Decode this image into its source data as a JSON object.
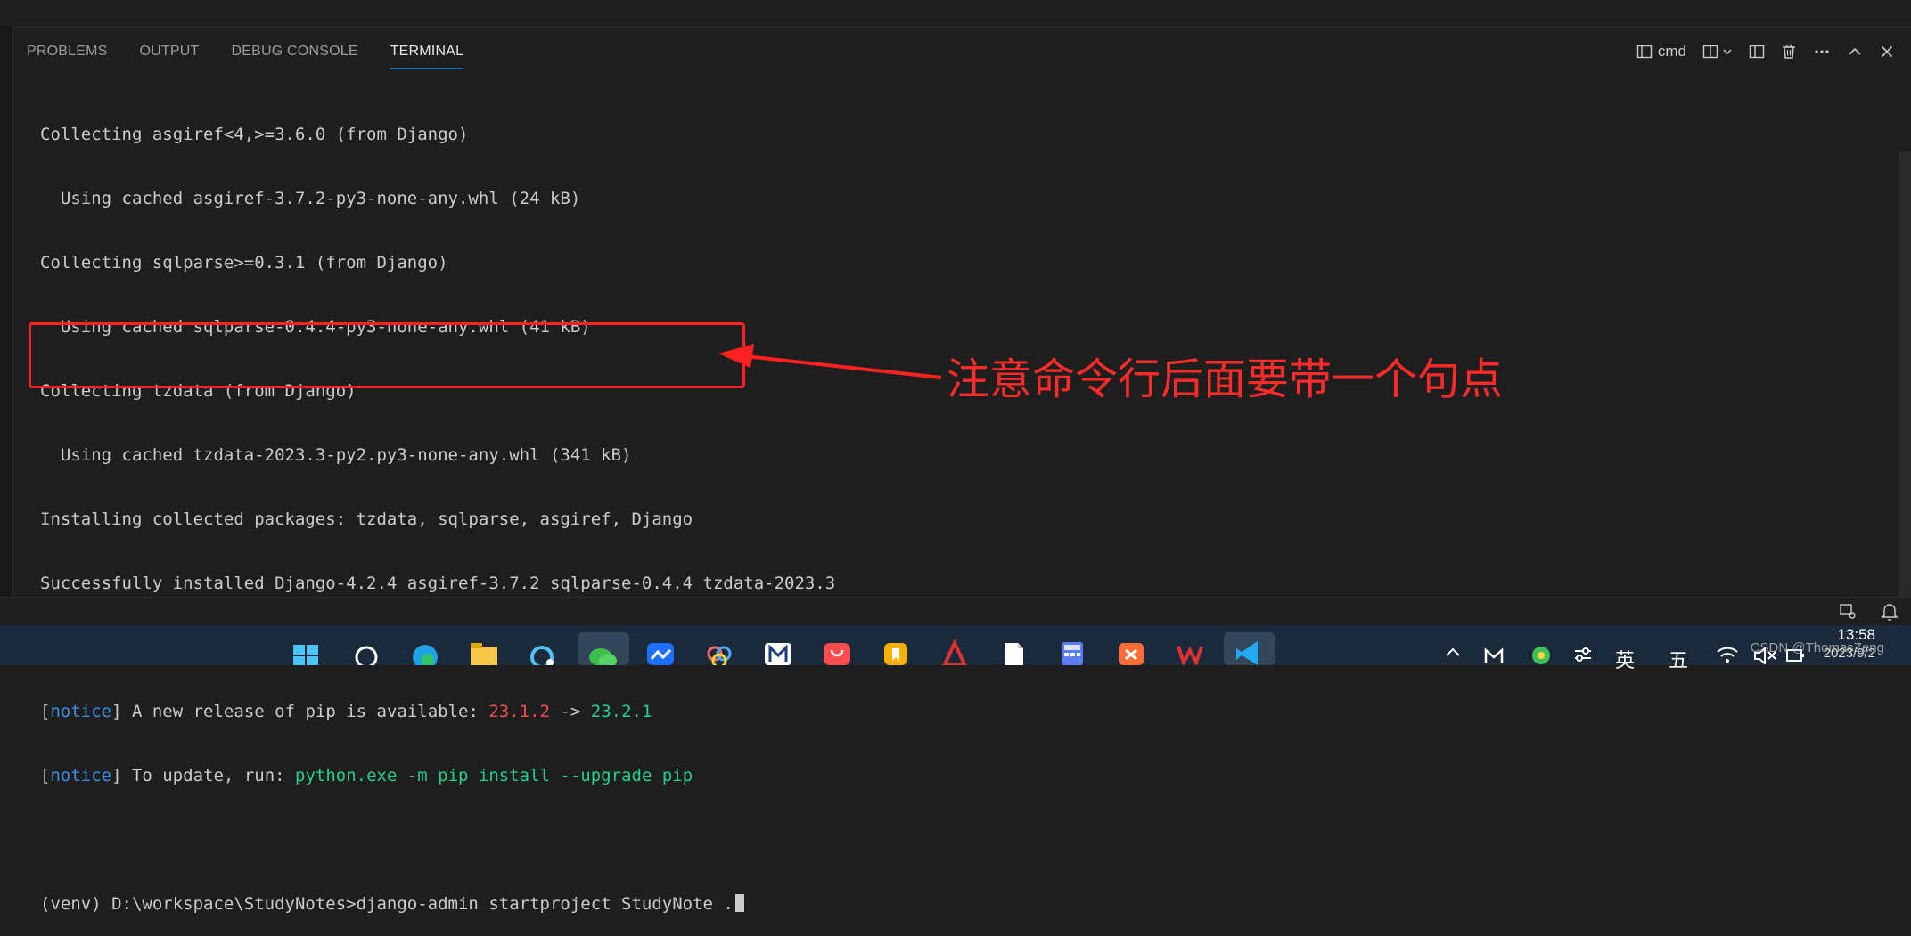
{
  "panel": {
    "tabs": [
      {
        "label": "PROBLEMS",
        "active": false
      },
      {
        "label": "OUTPUT",
        "active": false
      },
      {
        "label": "DEBUG CONSOLE",
        "active": false
      },
      {
        "label": "TERMINAL",
        "active": true
      }
    ],
    "actions": {
      "terminal_name": "cmd",
      "icons": [
        "terminal-icon",
        "split-terminal-icon",
        "chevron-down-icon",
        "split-editor-icon",
        "trash-icon",
        "more-icon",
        "maximize-icon",
        "close-icon"
      ]
    }
  },
  "terminal": {
    "lines": [
      "Collecting asgiref<4,>=3.6.0 (from Django)",
      "  Using cached asgiref-3.7.2-py3-none-any.whl (24 kB)",
      "Collecting sqlparse>=0.3.1 (from Django)",
      "  Using cached sqlparse-0.4.4-py3-none-any.whl (41 kB)",
      "Collecting tzdata (from Django)",
      "  Using cached tzdata-2023.3-py2.py3-none-any.whl (341 kB)",
      "Installing collected packages: tzdata, sqlparse, asgiref, Django",
      "Successfully installed Django-4.2.4 asgiref-3.7.2 sqlparse-0.4.4 tzdata-2023.3"
    ],
    "notice1": {
      "open": "[",
      "tag": "notice",
      "close": "]",
      "text": " A new release of pip is available: ",
      "old_version": "23.1.2",
      "arrow": " -> ",
      "new_version": "23.2.1"
    },
    "notice2": {
      "open": "[",
      "tag": "notice",
      "close": "]",
      "text": " To update, run: ",
      "command": "python.exe -m pip install --upgrade pip"
    },
    "prompt": "(venv) D:\\workspace\\StudyNotes>django-admin startproject StudyNote ."
  },
  "annotation": {
    "text": "注意命令行后面要带一个句点",
    "color": "#ff2a2a"
  },
  "taskbar": {
    "apps": [
      "start-icon",
      "search-icon",
      "edge-icon",
      "file-explorer-icon",
      "app-icon",
      "wechat-icon",
      "lark-icon",
      "photos-icon",
      "mark-icon",
      "huawei-appgallery-icon",
      "bookmark-app-icon",
      "red-app-icon",
      "file-icon",
      "calculator-icon",
      "tool-app-icon",
      "wps-icon",
      "vscode-icon"
    ],
    "tray": {
      "ime_lang": "英",
      "ime_mode": "五",
      "time": "13:58",
      "date": "2023/9/2"
    }
  },
  "watermark": "CSDN @ThomasZeng",
  "colors": {
    "bg": "#1e1e1e",
    "text": "#cccccc",
    "accent": "#0078d4",
    "notice_blue": "#3b8eea",
    "old_version_red": "#f14c4c",
    "green": "#23d18b",
    "highlight_red": "#ff2020"
  }
}
